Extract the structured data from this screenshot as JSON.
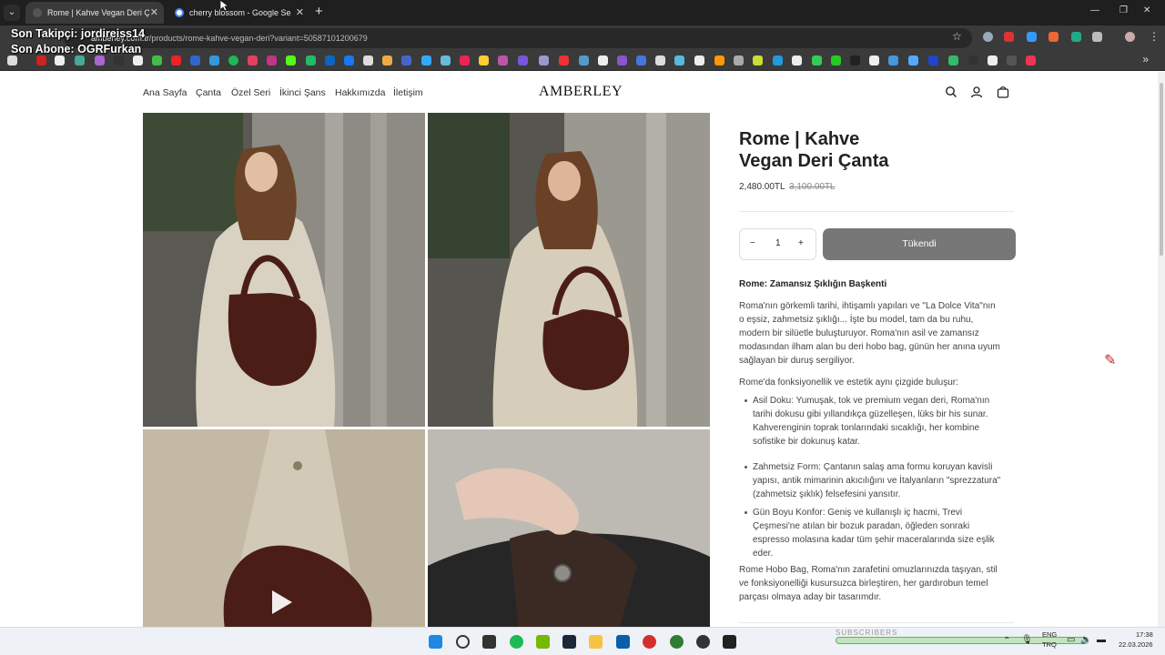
{
  "browser": {
    "tabs": [
      {
        "title": "Rome | Kahve Vegan Deri Çanta",
        "active": true
      },
      {
        "title": "cherry blossom - Google Search",
        "active": false
      }
    ],
    "url_host": "amberley.com.tr",
    "url_path": "/products/rome-kahve-vegan-deri?variant=50587101200679"
  },
  "stream_overlay": {
    "last_follower": "Son Takipçi: jordireiss14",
    "last_subscriber": "Son Abone: OGRFurkan"
  },
  "site": {
    "logo": "AMBERLEY",
    "nav": [
      "Ana Sayfa",
      "Çanta",
      "Özel Seri",
      "İkinci Şans",
      "Hakkımızda",
      "İletişim"
    ],
    "icons": [
      "search-icon",
      "account-icon",
      "cart-icon"
    ]
  },
  "product": {
    "title_line1": "Rome | Kahve",
    "title_line2": "Vegan Deri Çanta",
    "price": "2,480.00TL",
    "compare_price": "3,100.00TL",
    "quantity": "1",
    "button_label": "Tükendi",
    "heading": "Rome: Zamansız Şıklığın Başkenti",
    "intro": "Roma'nın görkemli tarihi, ihtişamlı yapıları ve \"La Dolce Vita\"nın o eşsiz, zahmetsiz şıklığı... İşte bu model, tam da bu ruhu, modern bir silüetle buluşturuyor. Roma'nın asil ve zamansız modasından ilham alan bu deri hobo bag, günün her anına uyum sağlayan bir duruş sergiliyor.",
    "lead": "Rome'da fonksiyonellik ve estetik aynı çizgide buluşur:",
    "bullets": [
      "Asil Doku: Yumuşak, tok ve premium vegan deri, Roma'nın tarihi dokusu gibi yıllandıkça güzelleşen, lüks bir his sunar. Kahverenginin toprak tonlarındaki sıcaklığı, her kombine sofistike bir dokunuş katar.",
      "Zahmetsiz Form: Çantanın salaş ama formu koruyan kavisli yapısı, antik mimarinin akıcılığını ve İtalyanların \"sprezzatura\" (zahmetsiz şıklık) felsefesini yansıtır.",
      "Gün Boyu Konfor: Geniş ve kullanışlı iç hacmi, Trevi Çeşmesi'ne atılan bir bozuk paradan, öğleden sonraki espresso molasına kadar tüm şehir maceralarında size eşlik eder."
    ],
    "outro": "Rome Hobo Bag, Roma'nın zarafetini omuzlarınızda taşıyan, stil ve fonksiyonelliği kusursuzca birleştiren, her gardırobun temel parçası olmaya aday bir tasarımdır."
  },
  "taskbar": {
    "subscribers_label": "SUBSCRIBERS",
    "lang_1": "ENG",
    "lang_2": "TRQ",
    "time": "17:38",
    "date": "22.03.2026"
  },
  "colors": {
    "button_disabled": "#777777",
    "bag_brown": "#4a1e17",
    "chrome_dark": "#1f1f1f"
  }
}
